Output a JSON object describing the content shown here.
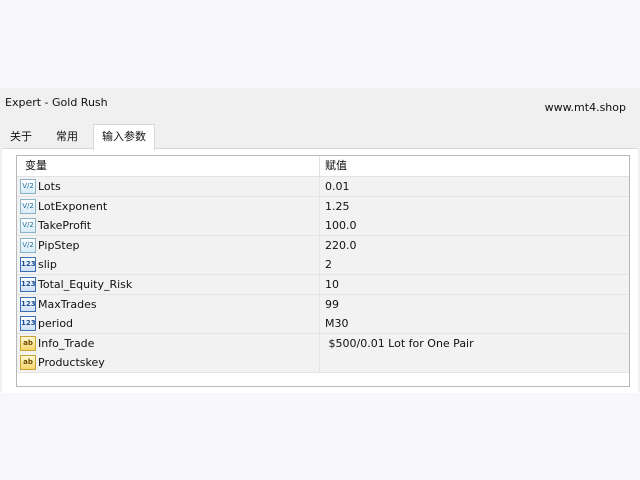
{
  "window": {
    "title": "Expert - Gold Rush",
    "watermark": "www.mt4.shop"
  },
  "tabs": [
    {
      "label": "关于",
      "active": false
    },
    {
      "label": "常用",
      "active": false
    },
    {
      "label": "输入参数",
      "active": true
    }
  ],
  "table": {
    "headers": {
      "variable": "变量",
      "value": "赋值"
    },
    "rows": [
      {
        "icon_text": "V/2",
        "icon_type": "double",
        "name": "Lots",
        "value": "0.01"
      },
      {
        "icon_text": "V/2",
        "icon_type": "double",
        "name": "LotExponent",
        "value": "1.25"
      },
      {
        "icon_text": "V/2",
        "icon_type": "double",
        "name": "TakeProfit",
        "value": "100.0"
      },
      {
        "icon_text": "V/2",
        "icon_type": "double",
        "name": "PipStep",
        "value": "220.0"
      },
      {
        "icon_text": "123",
        "icon_type": "int",
        "name": "slip",
        "value": "2"
      },
      {
        "icon_text": "123",
        "icon_type": "int",
        "name": "Total_Equity_Risk",
        "value": "10"
      },
      {
        "icon_text": "123",
        "icon_type": "int",
        "name": "MaxTrades",
        "value": "99"
      },
      {
        "icon_text": "123",
        "icon_type": "int",
        "name": "period",
        "value": "M30"
      },
      {
        "icon_text": "ab",
        "icon_type": "string",
        "name": "Info_Trade",
        "value": " $500/0.01 Lot for One Pair"
      },
      {
        "icon_text": "ab",
        "icon_type": "string",
        "name": "Productskey",
        "value": ""
      }
    ]
  },
  "colors": {
    "row_background": "#f2f2f2",
    "panel_background": "#ffffff",
    "window_background": "#f0f0f0"
  }
}
